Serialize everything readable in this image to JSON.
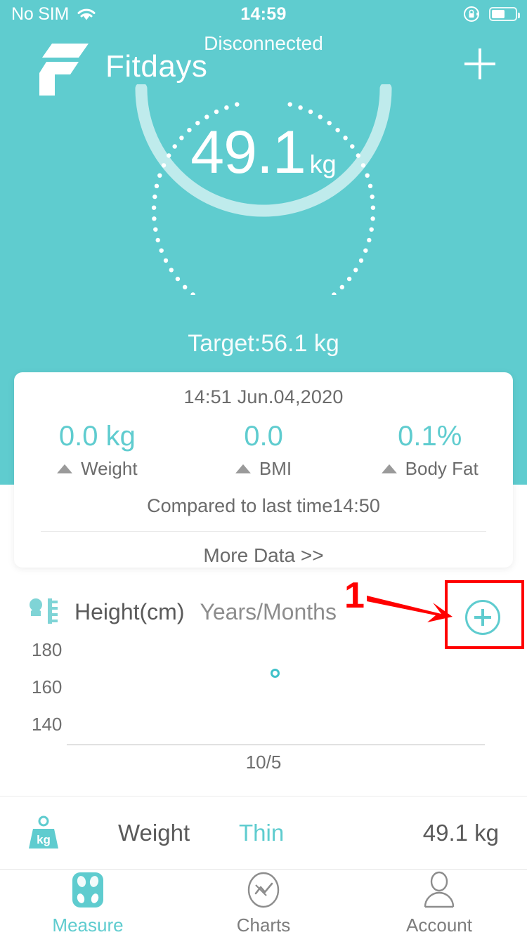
{
  "status_bar": {
    "carrier": "No SIM",
    "wifi_icon": "wifi-icon",
    "time": "14:59",
    "rotation_lock_icon": "rotation-lock-icon",
    "battery_icon": "battery-icon",
    "battery_level_pct": 55
  },
  "header": {
    "connection_status": "Disconnected",
    "app_title": "Fitdays",
    "logo_icon": "fitdays-logo-icon",
    "add_button_icon": "plus-icon"
  },
  "dial": {
    "value": "49.1",
    "unit": "kg",
    "target_text": "Target:56.1 kg"
  },
  "summary_card": {
    "timestamp": "14:51 Jun.04,2020",
    "metrics": [
      {
        "value": "0.0 kg",
        "label": "Weight",
        "trend_icon": "triangle-up-icon"
      },
      {
        "value": "0.0",
        "label": "BMI",
        "trend_icon": "triangle-up-icon"
      },
      {
        "value": "0.1%",
        "label": "Body Fat",
        "trend_icon": "triangle-up-icon"
      }
    ],
    "compared_text": "Compared to last time14:50",
    "more_data_label": "More Data >>"
  },
  "height_chart": {
    "icon": "person-ruler-icon",
    "title": "Height(cm)",
    "subtitle": "Years/Months",
    "add_button_icon": "circle-plus-icon"
  },
  "chart_data": {
    "type": "scatter",
    "title": "Height(cm)",
    "xlabel": "Years/Months",
    "ylabel": "Height(cm)",
    "categories": [
      "10/5"
    ],
    "x": [
      "10/5"
    ],
    "values": [
      165
    ],
    "yticks": [
      "180",
      "160",
      "140"
    ],
    "ylim": [
      130,
      190
    ],
    "grid": false,
    "legend": null,
    "series": [
      {
        "name": "Height",
        "values": [
          165
        ],
        "color": "#3FC1C9"
      }
    ]
  },
  "weight_row": {
    "icon": "kg-weight-icon",
    "name": "Weight",
    "state": "Thin",
    "value": "49.1 kg"
  },
  "tab_bar": {
    "tabs": [
      {
        "label": "Measure",
        "icon": "scale-icon",
        "active": true
      },
      {
        "label": "Charts",
        "icon": "chart-circle-icon",
        "active": false
      },
      {
        "label": "Account",
        "icon": "person-icon",
        "active": false
      }
    ]
  },
  "annotation": {
    "step_number": "1",
    "arrow_icon": "red-arrow-icon",
    "highlight_icon": "red-highlight-box",
    "color": "#FF0000"
  },
  "colors": {
    "brand_teal": "#5FCCCF",
    "accent_teal": "#3FC1C9",
    "text_gray": "#5a5a5a",
    "muted_gray": "#8d8d8d",
    "white": "#ffffff",
    "annotation_red": "#FF0000"
  }
}
